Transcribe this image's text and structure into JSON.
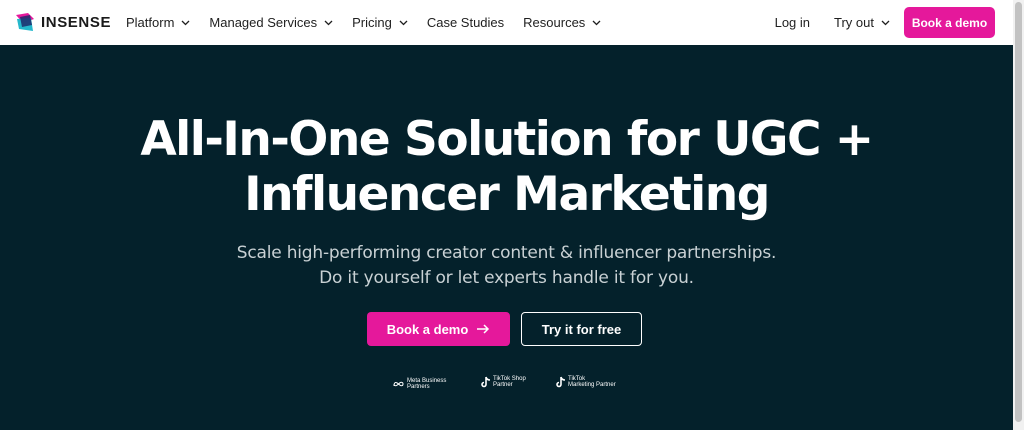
{
  "header": {
    "logo_text": "INSENSE",
    "nav": [
      {
        "label": "Platform",
        "has_dropdown": true
      },
      {
        "label": "Managed Services",
        "has_dropdown": true
      },
      {
        "label": "Pricing",
        "has_dropdown": true
      },
      {
        "label": "Case Studies",
        "has_dropdown": false
      },
      {
        "label": "Resources",
        "has_dropdown": true
      }
    ],
    "login_label": "Log in",
    "tryout_label": "Try out",
    "book_demo_label": "Book a demo"
  },
  "hero": {
    "headline_line1": "All-In-One Solution for UGC +",
    "headline_line2": "Influencer Marketing",
    "sub_line1": "Scale high-performing creator content & influencer partnerships.",
    "sub_line2": "Do it yourself or let experts handle it for you.",
    "primary_cta": "Book a demo",
    "secondary_cta": "Try it for free"
  },
  "partners": [
    {
      "icon": "meta-logo-icon",
      "line1": "Meta Business",
      "line2": "Partners"
    },
    {
      "icon": "tiktok-logo-icon",
      "line1": "TikTok Shop",
      "line2": "Partner"
    },
    {
      "icon": "tiktok-logo-icon",
      "line1": "TikTok",
      "line2": "Marketing Partner"
    }
  ],
  "colors": {
    "accent": "#e5189b",
    "hero_bg": "#04212b",
    "header_bg": "#ffffff"
  }
}
